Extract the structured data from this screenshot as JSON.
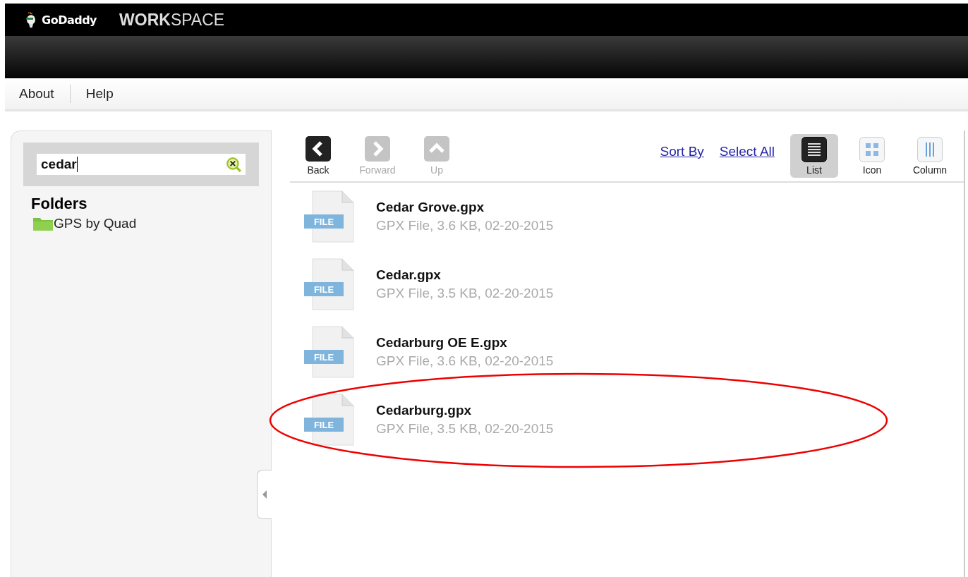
{
  "header": {
    "brand": "GoDaddy",
    "product": "**WORK**SPACE"
  },
  "menu": [
    "About",
    "Help"
  ],
  "sidebar": {
    "search": {
      "value": "cedar"
    },
    "folders_title": "Folders",
    "folders": [
      {
        "name": "GPS by Quad"
      }
    ]
  },
  "toolbar": {
    "nav": [
      {
        "label": "Back",
        "kind": "back",
        "disabled": false
      },
      {
        "label": "Forward",
        "kind": "forward",
        "disabled": true
      },
      {
        "label": "Up",
        "kind": "up",
        "disabled": true
      }
    ],
    "links": [
      "Sort By",
      "Select All"
    ],
    "views": [
      {
        "label": "List",
        "kind": "list",
        "selected": true
      },
      {
        "label": "Icon",
        "kind": "icon",
        "selected": false
      },
      {
        "label": "Column",
        "kind": "column",
        "selected": false
      }
    ]
  },
  "files": [
    {
      "name": "Cedar Grove.gpx",
      "details": "GPX File, 3.6 KB, 02-20-2015",
      "icon_label": "FILE",
      "circled": false
    },
    {
      "name": "Cedar.gpx",
      "details": "GPX File, 3.5 KB, 02-20-2015",
      "icon_label": "FILE",
      "circled": false
    },
    {
      "name": "Cedarburg OE E.gpx",
      "details": "GPX File, 3.6 KB, 02-20-2015",
      "icon_label": "FILE",
      "circled": false
    },
    {
      "name": "Cedarburg.gpx",
      "details": "GPX File, 3.5 KB, 02-20-2015",
      "icon_label": "FILE",
      "circled": true
    }
  ]
}
